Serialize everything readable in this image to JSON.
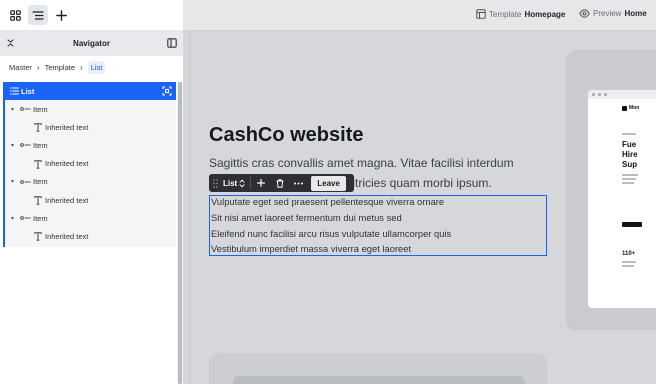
{
  "navigator": {
    "title": "Navigator",
    "breadcrumb": [
      "Master",
      "Template",
      "List"
    ],
    "tree": [
      {
        "label": "List",
        "selected": true,
        "level": 0,
        "icon": "list-icon"
      },
      {
        "label": "Item",
        "level": 1,
        "icon": "item-icon"
      },
      {
        "label": "Inherited text",
        "level": 2,
        "icon": "text-icon"
      },
      {
        "label": "Item",
        "level": 1,
        "icon": "item-icon"
      },
      {
        "label": "Inherited text",
        "level": 2,
        "icon": "text-icon"
      },
      {
        "label": "Item",
        "level": 1,
        "icon": "item-icon"
      },
      {
        "label": "Inherited text",
        "level": 2,
        "icon": "text-icon"
      },
      {
        "label": "Item",
        "level": 1,
        "icon": "item-icon"
      },
      {
        "label": "Inherited text",
        "level": 2,
        "icon": "text-icon"
      }
    ]
  },
  "topbar": {
    "template_prefix": "Template",
    "template_name": "Homepage",
    "preview_prefix": "Preview",
    "preview_name": "Home"
  },
  "canvas": {
    "title": "CashCo website",
    "description_line1": "Sagittis cras convallis amet magna. Vitae facilisi interdum",
    "description_line2": "m. Ultricies quam morbi ipsum.",
    "list_items": [
      "Vulputate eget sed praesent pellentesque viverra ornare",
      "Sit nisi amet laoreet fermentum dui metus sed",
      "Eleifend nunc facilisi arcu risus vulputate ullamcorper quis",
      "Vestibulum imperdiet massa viverra eget laoreet"
    ]
  },
  "context_toolbar": {
    "element_label": "List",
    "leave_label": "Leave"
  },
  "preview_mock": {
    "logo_text": "Mon",
    "headline": [
      "Fue",
      "Hire",
      "Sup"
    ],
    "number": "110+"
  },
  "colors": {
    "accent": "#1a63f5",
    "canvas_bg": "#d5d7da",
    "panel_bg": "#ffffff",
    "toolbar_dark": "#2d2f33"
  }
}
